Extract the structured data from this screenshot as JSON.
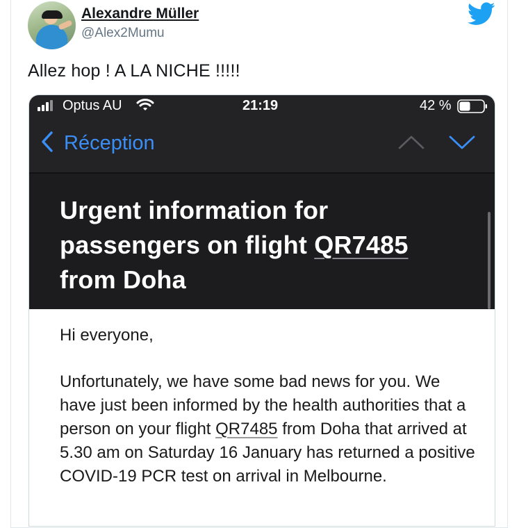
{
  "tweet": {
    "display_name": "Alexandre Müller",
    "handle": "@Alex2Mumu",
    "text": "Allez hop ! A LA NICHE !!!!!",
    "brand_color": "#1da1f2"
  },
  "phone": {
    "status_bar": {
      "carrier": "Optus AU",
      "time": "21:19",
      "battery": "42 %"
    },
    "nav": {
      "back_label": "Réception",
      "accent_color": "#3b8ef5"
    },
    "email": {
      "subject_line1": "Urgent information for",
      "subject_line2_prefix": "passengers on flight ",
      "subject_flight": "QR7485",
      "subject_line3": "from Doha",
      "greeting": "Hi everyone,",
      "body_part1": "Unfortunately, we have some bad news for you. We have just been informed by the health authorities that a person on your flight ",
      "body_flight": "QR7485",
      "body_part2": " from Doha that arrived at 5.30 am on Saturday 16 January has returned a positive COVID-19 PCR test on arrival in Melbourne."
    }
  }
}
